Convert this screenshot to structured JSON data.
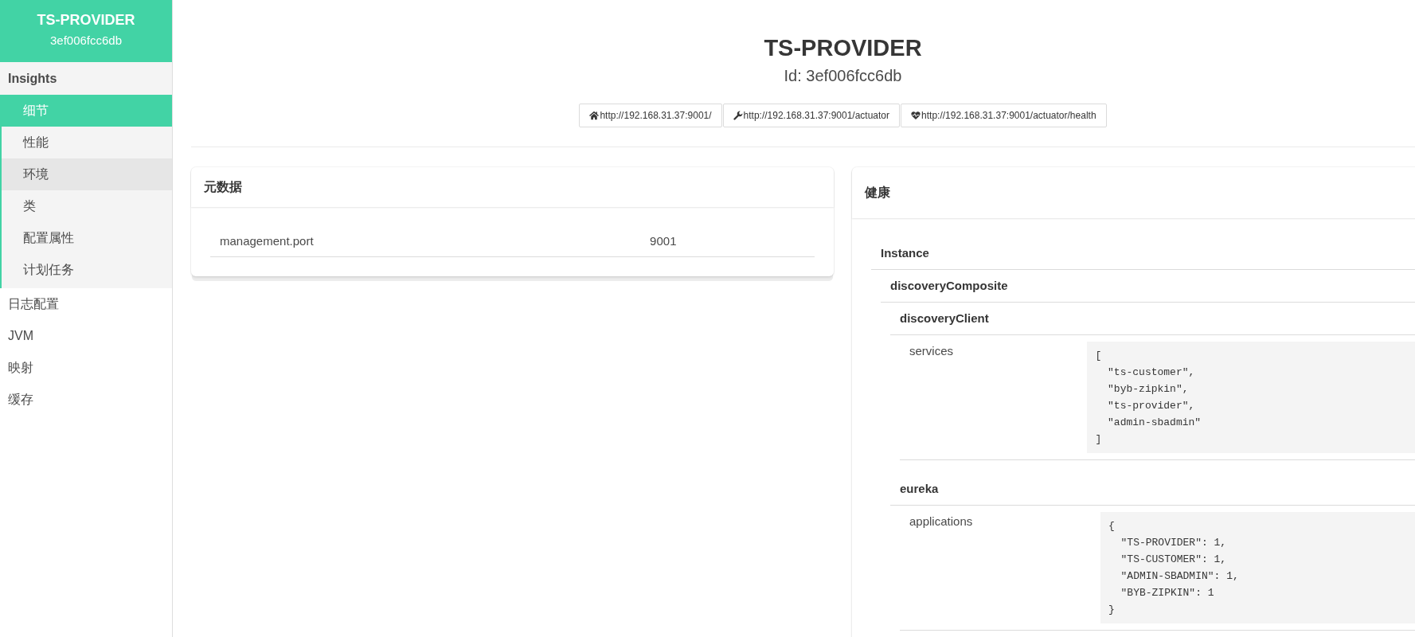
{
  "sidebar": {
    "app_name": "TS-PROVIDER",
    "instance_id": "3ef006fcc6db",
    "items": [
      {
        "kind": "group",
        "label": "Insights",
        "selected": false,
        "children": [
          {
            "label": "细节",
            "selected": true,
            "hovered": false
          },
          {
            "label": "性能",
            "selected": false,
            "hovered": false
          },
          {
            "label": "环境",
            "selected": false,
            "hovered": true
          },
          {
            "label": "类",
            "selected": false,
            "hovered": false
          },
          {
            "label": "配置属性",
            "selected": false,
            "hovered": false
          },
          {
            "label": "计划任务",
            "selected": false,
            "hovered": false
          }
        ]
      },
      {
        "kind": "link",
        "label": "日志配置",
        "selected": false
      },
      {
        "kind": "link",
        "label": "JVM",
        "selected": false
      },
      {
        "kind": "link",
        "label": "映射",
        "selected": false
      },
      {
        "kind": "link",
        "label": "缓存",
        "selected": false
      }
    ]
  },
  "header": {
    "title": "TS-PROVIDER",
    "subtitle": "Id: 3ef006fcc6db",
    "links": [
      {
        "kind": "home",
        "url": "http://192.168.31.37:9001/"
      },
      {
        "kind": "actuator",
        "url": "http://192.168.31.37:9001/actuator"
      },
      {
        "kind": "health",
        "url": "http://192.168.31.37:9001/actuator/health"
      }
    ]
  },
  "metadata_card": {
    "title": "元数据",
    "rows": [
      {
        "key": "management.port",
        "value": "9001"
      }
    ]
  },
  "health_card": {
    "title": "健康",
    "groups": [
      {
        "name": "Instance",
        "children": [
          {
            "name": "discoveryComposite",
            "children": [
              {
                "name": "discoveryClient",
                "details": [
                  {
                    "key": "services",
                    "value": "[\n  \"ts-customer\",\n  \"byb-zipkin\",\n  \"ts-provider\",\n  \"admin-sbadmin\"\n]"
                  }
                ]
              },
              {
                "name": "eureka",
                "details": [
                  {
                    "key": "applications",
                    "value": "{\n  \"TS-PROVIDER\": 1,\n  \"TS-CUSTOMER\": 1,\n  \"ADMIN-SBADMIN\": 1,\n  \"BYB-ZIPKIN\": 1\n}"
                  }
                ]
              }
            ]
          }
        ]
      }
    ]
  }
}
